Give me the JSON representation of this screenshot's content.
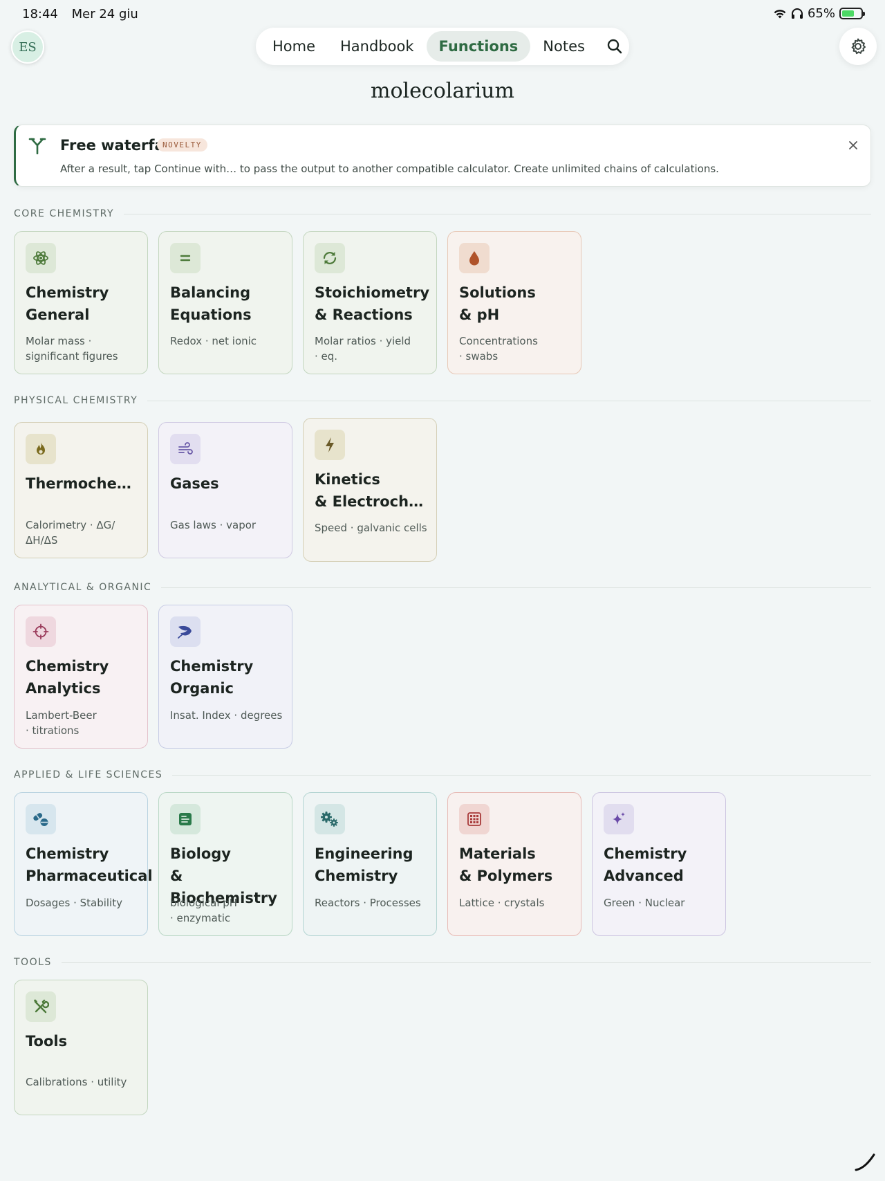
{
  "status_bar": {
    "time": "18:44",
    "date": "Mer 24 giu",
    "battery_percent": "65%",
    "battery_level": 0.65
  },
  "header": {
    "avatar_initials": "ES",
    "nav_tabs": [
      {
        "label": "Home",
        "active": false
      },
      {
        "label": "Handbook",
        "active": false
      },
      {
        "label": "Functions",
        "active": true
      },
      {
        "label": "Notes",
        "active": false
      }
    ],
    "app_title": "molecolarium"
  },
  "banner": {
    "title": "Free waterfall",
    "badge": "NOVELTY",
    "text": "After a result, tap Continue with… to pass the output to another compatible calculator. Create unlimited chains of calculations."
  },
  "sections": [
    {
      "label": "CORE CHEMISTRY",
      "cards": [
        {
          "title": "Chemistry\nGeneral",
          "subtitle": "Molar mass ·\nsignificant figures",
          "icon": "atom-icon",
          "color": "#4d7a3a"
        },
        {
          "title": "Balancing\nEquations",
          "subtitle": "Redox · net ionic",
          "icon": "equals-icon",
          "color": "#4d7a3a"
        },
        {
          "title": "Stoichiometry\n& Reactions",
          "subtitle": "Molar ratios · yield\n· eq.",
          "icon": "refresh-icon",
          "color": "#4d7a3a"
        },
        {
          "title": "Solutions\n& pH",
          "subtitle": "Concentrations\n· swabs",
          "icon": "drop-icon",
          "color": "#b0532a"
        }
      ]
    },
    {
      "label": "PHYSICAL CHEMISTRY",
      "cards": [
        {
          "title": "Thermochemi…",
          "subtitle": "Calorimetry · ΔG/\nΔH/ΔS",
          "icon": "flame-icon",
          "color": "#7a6a1e"
        },
        {
          "title": "Gases",
          "subtitle": "Gas laws · vapor",
          "icon": "wind-icon",
          "color": "#6a5aa8"
        },
        {
          "title": "Kinetics\n& Electrochem…",
          "subtitle": "Speed · galvanic cells",
          "icon": "bolt-icon",
          "color": "#6a5a28"
        }
      ]
    },
    {
      "label": "ANALYTICAL & ORGANIC",
      "cards": [
        {
          "title": "Chemistry\nAnalytics",
          "subtitle": "Lambert-Beer\n· titrations",
          "icon": "crosshair-icon",
          "color": "#9a3a5a"
        },
        {
          "title": "Chemistry\nOrganic",
          "subtitle": "Insat. Index · degrees",
          "icon": "leaf-icon",
          "color": "#3a4a9a"
        }
      ]
    },
    {
      "label": "APPLIED & LIFE SCIENCES",
      "cards": [
        {
          "title": "Chemistry\nPharmaceutical",
          "subtitle": "Dosages · Stability",
          "icon": "pills-icon",
          "color": "#2a6a8a"
        },
        {
          "title": "Biology\n& Biochemistry",
          "subtitle": "biological pH\n· enzymatic",
          "icon": "notebook-icon",
          "color": "#2a7a4a"
        },
        {
          "title": "Engineering\nChemistry",
          "subtitle": "Reactors · Processes",
          "icon": "gears-icon",
          "color": "#2a6a6a"
        },
        {
          "title": "Materials\n& Polymers",
          "subtitle": "Lattice · crystals",
          "icon": "grid-icon",
          "color": "#a83a3a"
        },
        {
          "title": "Chemistry\nAdvanced",
          "subtitle": "Green · Nuclear",
          "icon": "sparkle-icon",
          "color": "#6a4aa8"
        }
      ]
    },
    {
      "label": "TOOLS",
      "cards": [
        {
          "title": "Tools",
          "subtitle": "Calibrations · utility",
          "icon": "tools-icon",
          "color": "#4d7a3a"
        }
      ]
    }
  ]
}
